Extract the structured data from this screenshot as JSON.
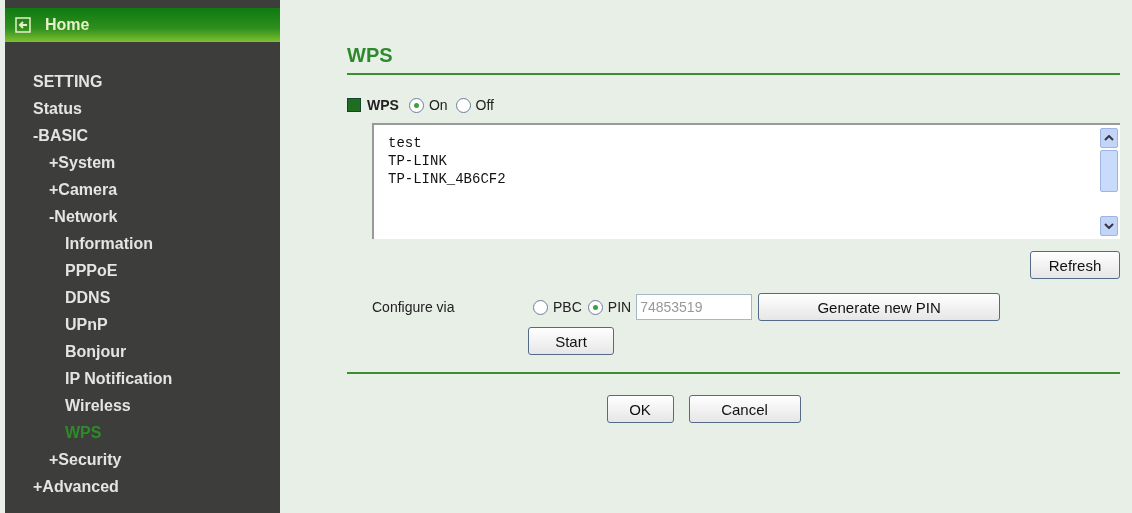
{
  "sidebar": {
    "home": "Home",
    "items": [
      {
        "label": "SETTING",
        "selected": false
      },
      {
        "label": "Status",
        "selected": false
      },
      {
        "label": "-BASIC",
        "selected": false,
        "children": [
          {
            "label": "+System",
            "selected": false
          },
          {
            "label": "+Camera",
            "selected": false
          },
          {
            "label": "-Network",
            "selected": false,
            "children": [
              {
                "label": "Information",
                "selected": false
              },
              {
                "label": "PPPoE",
                "selected": false
              },
              {
                "label": "DDNS",
                "selected": false
              },
              {
                "label": "UPnP",
                "selected": false
              },
              {
                "label": "Bonjour",
                "selected": false
              },
              {
                "label": "IP Notification",
                "selected": false
              },
              {
                "label": "Wireless",
                "selected": false
              },
              {
                "label": "WPS",
                "selected": true
              }
            ]
          },
          {
            "label": "+Security",
            "selected": false
          }
        ]
      },
      {
        "label": "+Advanced",
        "selected": false
      }
    ]
  },
  "main": {
    "title": "WPS",
    "wps": {
      "label": "WPS",
      "options": [
        {
          "label": "On",
          "selected": true
        },
        {
          "label": "Off",
          "selected": false
        }
      ]
    },
    "networks": [
      "test",
      "TP-LINK",
      "TP-LINK_4B6CF2"
    ],
    "refresh": "Refresh",
    "configure": {
      "label": "Configure via",
      "options": [
        {
          "label": "PBC",
          "selected": false
        },
        {
          "label": "PIN",
          "selected": true
        }
      ],
      "pin": {
        "value": "74853519",
        "disabled": true
      },
      "generate": "Generate new PIN",
      "start": "Start"
    },
    "buttons": [
      "OK",
      "Cancel"
    ]
  }
}
